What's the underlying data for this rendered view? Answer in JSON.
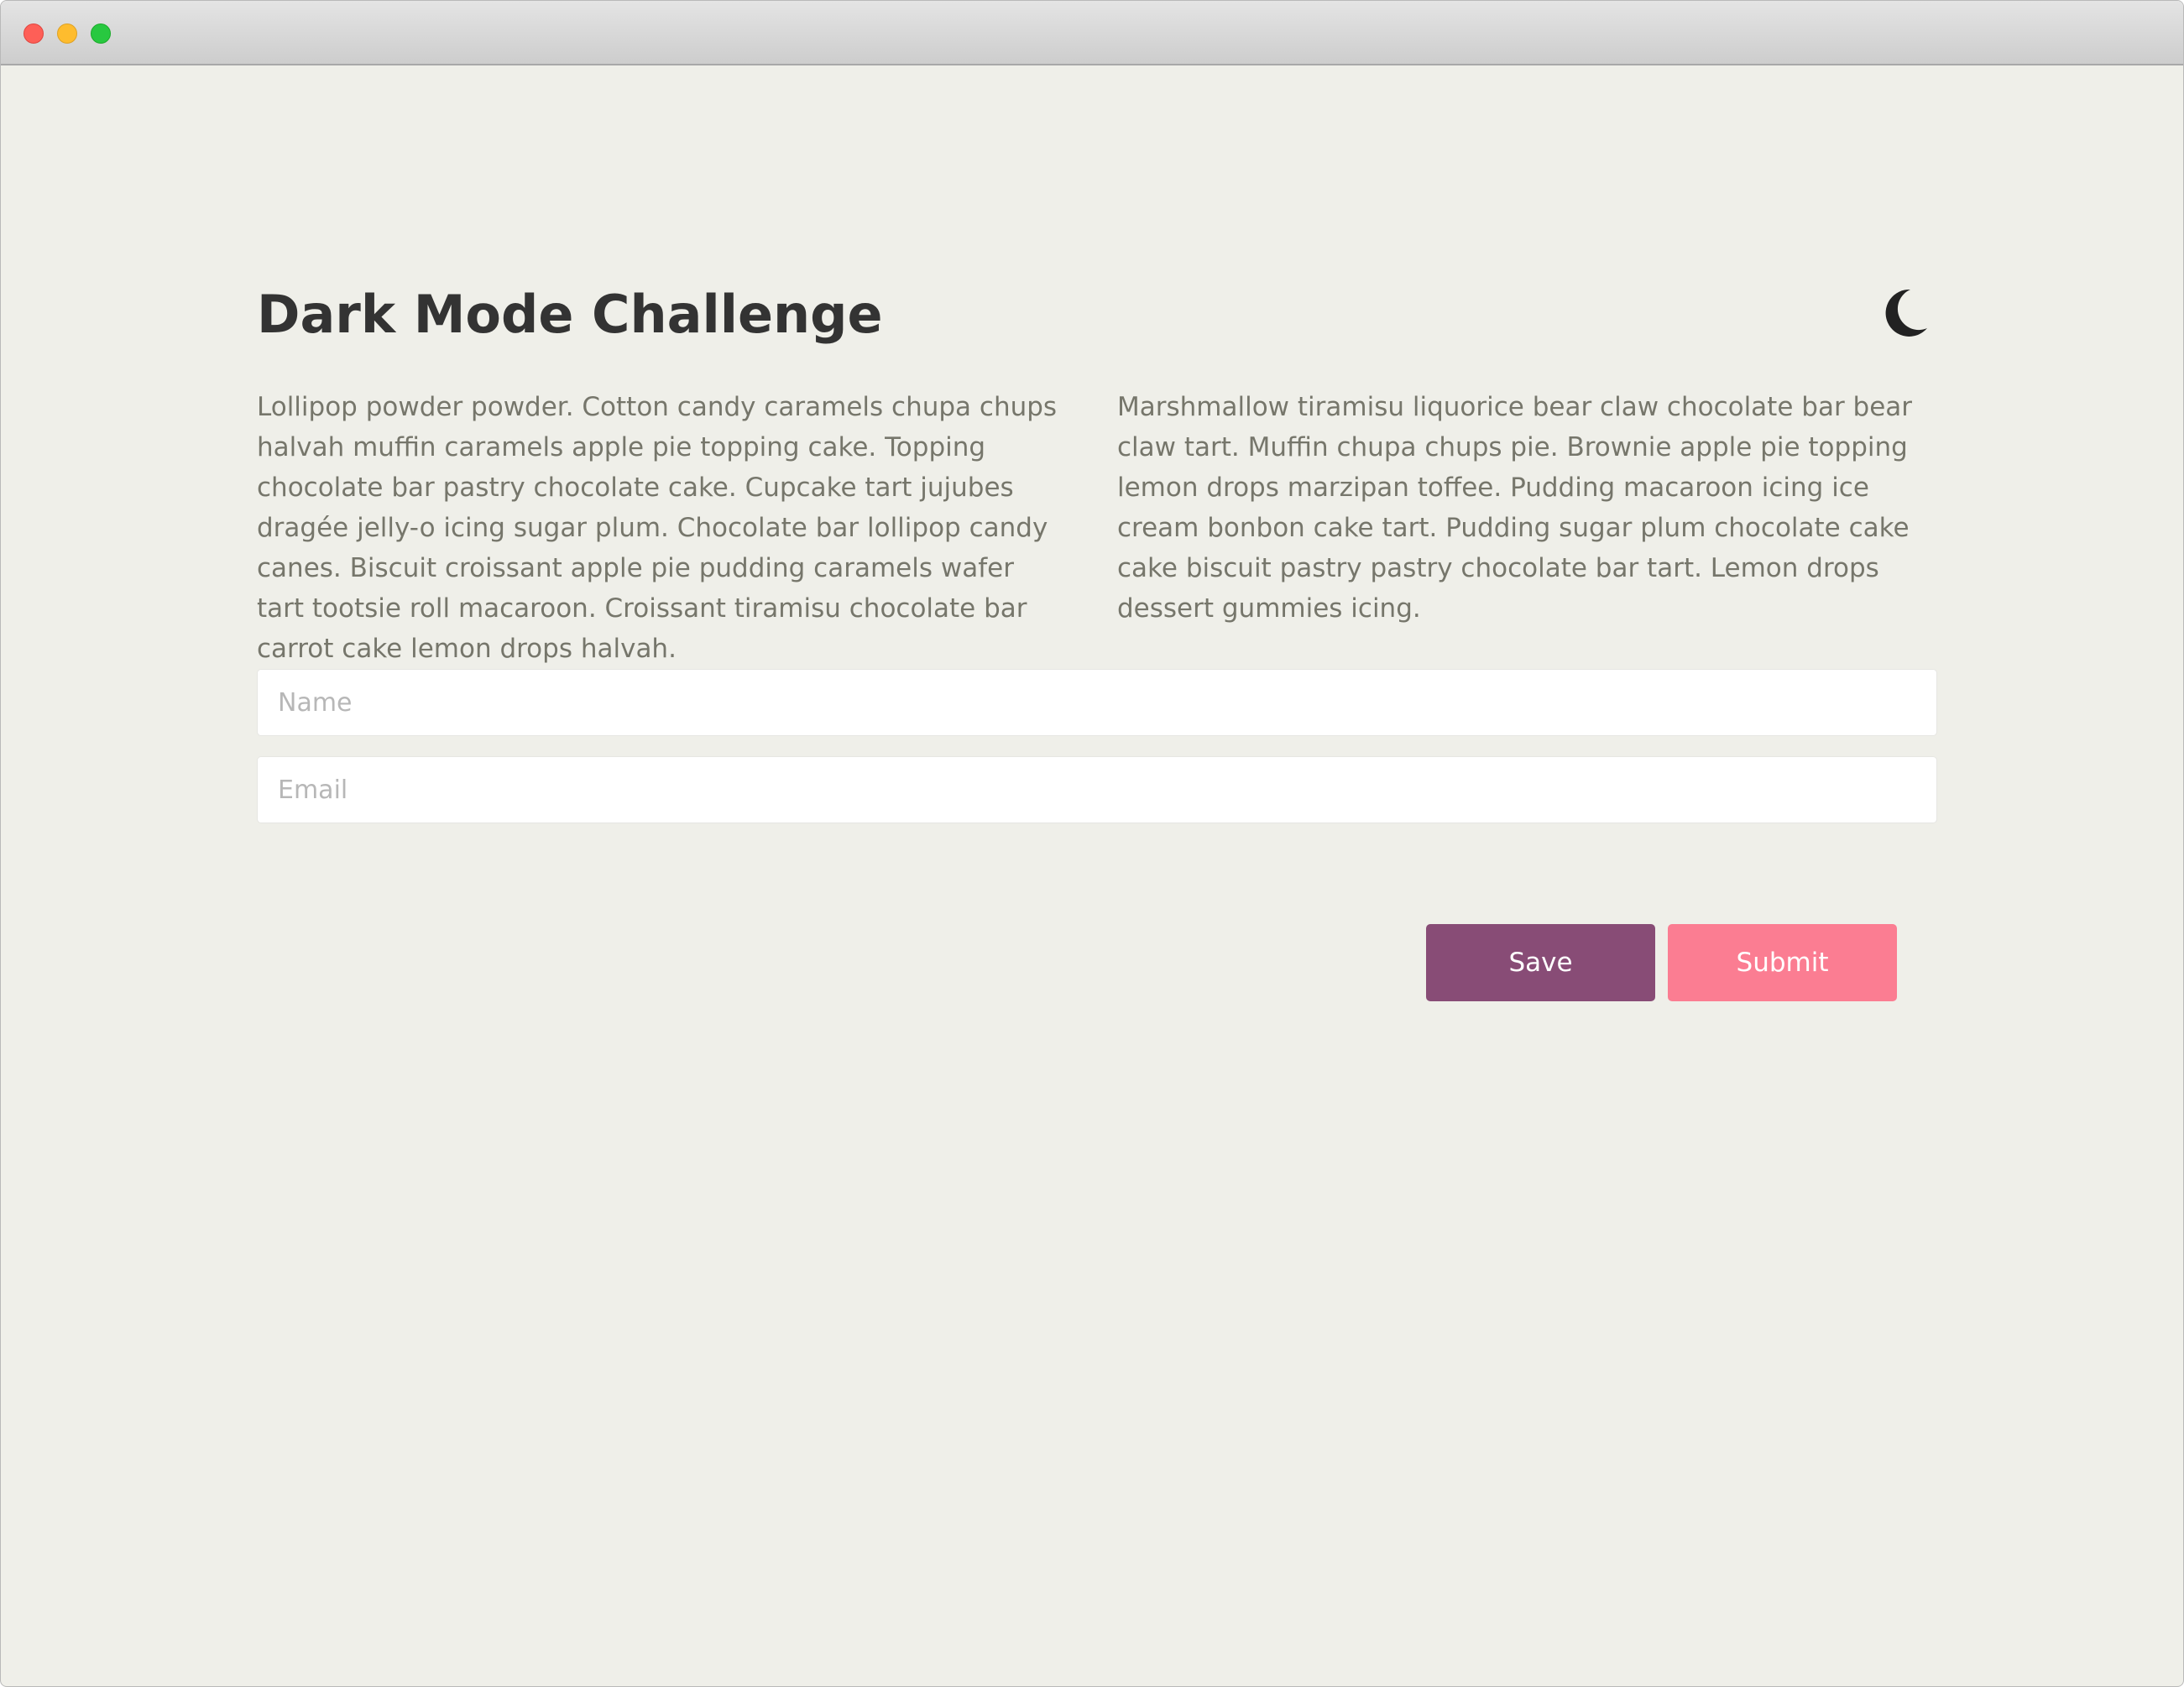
{
  "window": {
    "controls": [
      "close-button",
      "minimize-button",
      "zoom-button"
    ]
  },
  "header": {
    "title": "Dark Mode Challenge",
    "theme_toggle_icon": "moon-icon"
  },
  "content": {
    "paragraph_left": "Lollipop powder powder. Cotton candy caramels chupa chups halvah muffin caramels apple pie topping cake. Topping chocolate bar pastry chocolate cake. Cupcake tart jujubes dragée jelly-o icing sugar plum. Chocolate bar lollipop candy canes. Biscuit croissant apple pie pudding caramels wafer tart tootsie roll macaroon. Croissant tiramisu chocolate bar carrot cake lemon drops halvah.",
    "paragraph_right": "Marshmallow tiramisu liquorice bear claw chocolate bar bear claw tart. Muffin chupa chups pie. Brownie apple pie topping lemon drops marzipan toffee. Pudding macaroon icing ice cream bonbon cake tart. Pudding sugar plum chocolate cake cake biscuit pastry pastry chocolate bar tart. Lemon drops dessert gummies icing."
  },
  "form": {
    "name": {
      "value": "",
      "placeholder": "Name"
    },
    "email": {
      "value": "",
      "placeholder": "Email"
    },
    "save_label": "Save",
    "submit_label": "Submit"
  },
  "colors": {
    "background": "#efefe9",
    "title": "#333333",
    "body_text": "#76766b",
    "save_button": "#884c76",
    "submit_button": "#fb7d92",
    "moon": "#222222"
  }
}
